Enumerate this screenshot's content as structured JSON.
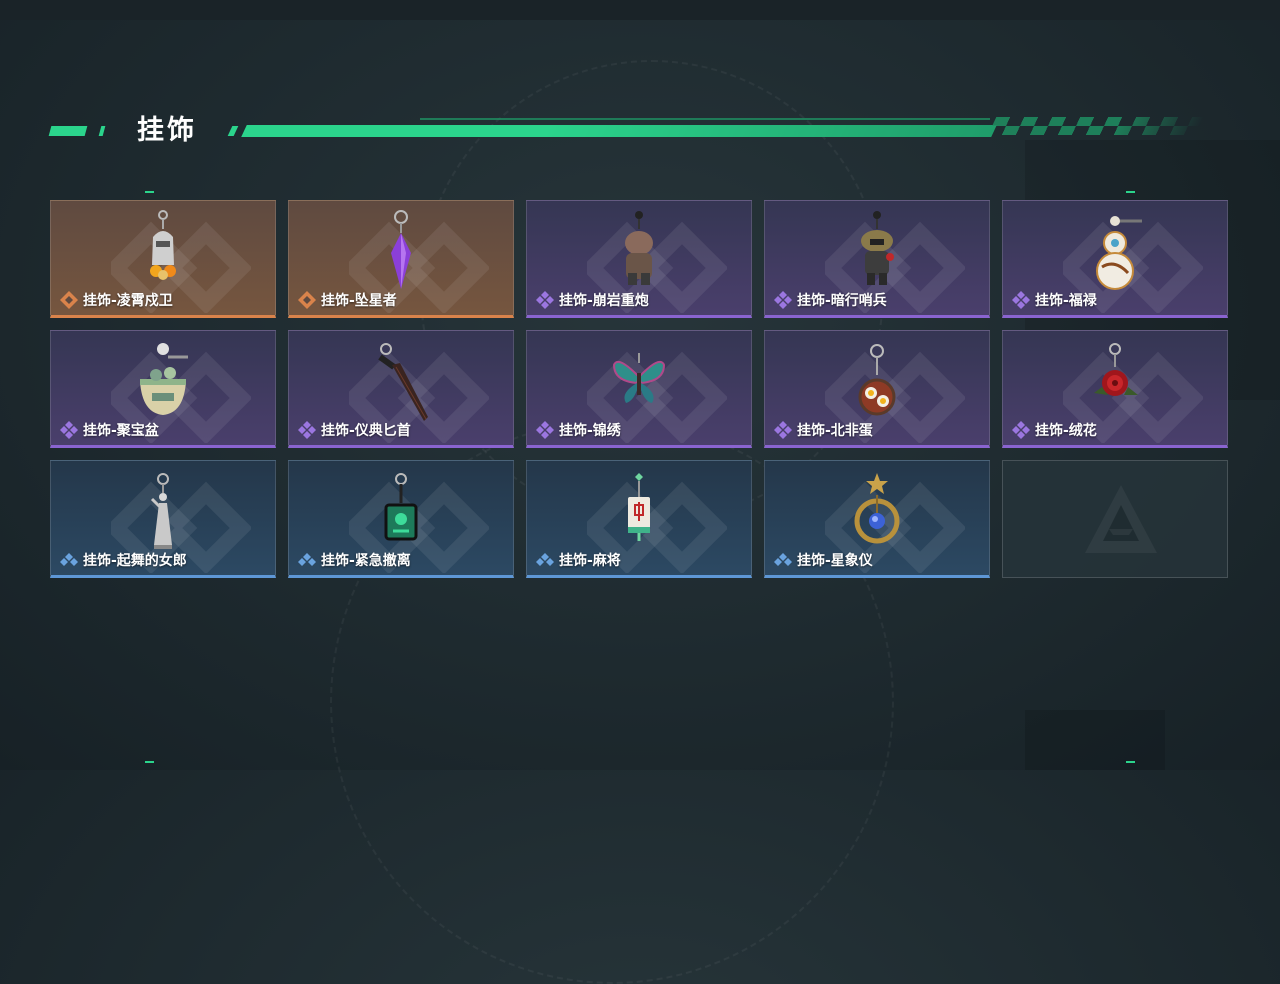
{
  "header": {
    "title": "挂饰"
  },
  "rarity_colors": {
    "orange": "#d9834b",
    "purple": "#8a64d0",
    "blue": "#5e97d6"
  },
  "items": [
    {
      "label": "挂饰-凌霄戍卫",
      "rarity": "orange",
      "icon": "knight-charm-icon"
    },
    {
      "label": "挂饰-坠星者",
      "rarity": "orange",
      "icon": "purple-crystal-charm-icon"
    },
    {
      "label": "挂饰-崩岩重炮",
      "rarity": "purple",
      "icon": "rock-gunner-charm-icon"
    },
    {
      "label": "挂饰-暗行哨兵",
      "rarity": "purple",
      "icon": "sentinel-charm-icon"
    },
    {
      "label": "挂饰-福禄",
      "rarity": "purple",
      "icon": "gourd-charm-icon"
    },
    {
      "label": "挂饰-聚宝盆",
      "rarity": "purple",
      "icon": "treasure-bowl-charm-icon"
    },
    {
      "label": "挂饰-仪典匕首",
      "rarity": "purple",
      "icon": "dagger-charm-icon"
    },
    {
      "label": "挂饰-锦绣",
      "rarity": "purple",
      "icon": "butterfly-charm-icon"
    },
    {
      "label": "挂饰-北非蛋",
      "rarity": "purple",
      "icon": "shakshuka-charm-icon"
    },
    {
      "label": "挂饰-绒花",
      "rarity": "purple",
      "icon": "red-flower-charm-icon"
    },
    {
      "label": "挂饰-起舞的女郎",
      "rarity": "blue",
      "icon": "dancer-charm-icon"
    },
    {
      "label": "挂饰-紧急撤离",
      "rarity": "blue",
      "icon": "emergency-exit-charm-icon"
    },
    {
      "label": "挂饰-麻将",
      "rarity": "blue",
      "icon": "mahjong-tile-charm-icon"
    },
    {
      "label": "挂饰-星象仪",
      "rarity": "blue",
      "icon": "astrolabe-charm-icon"
    }
  ],
  "empty_slot": {
    "icon": "game-logo-icon"
  }
}
